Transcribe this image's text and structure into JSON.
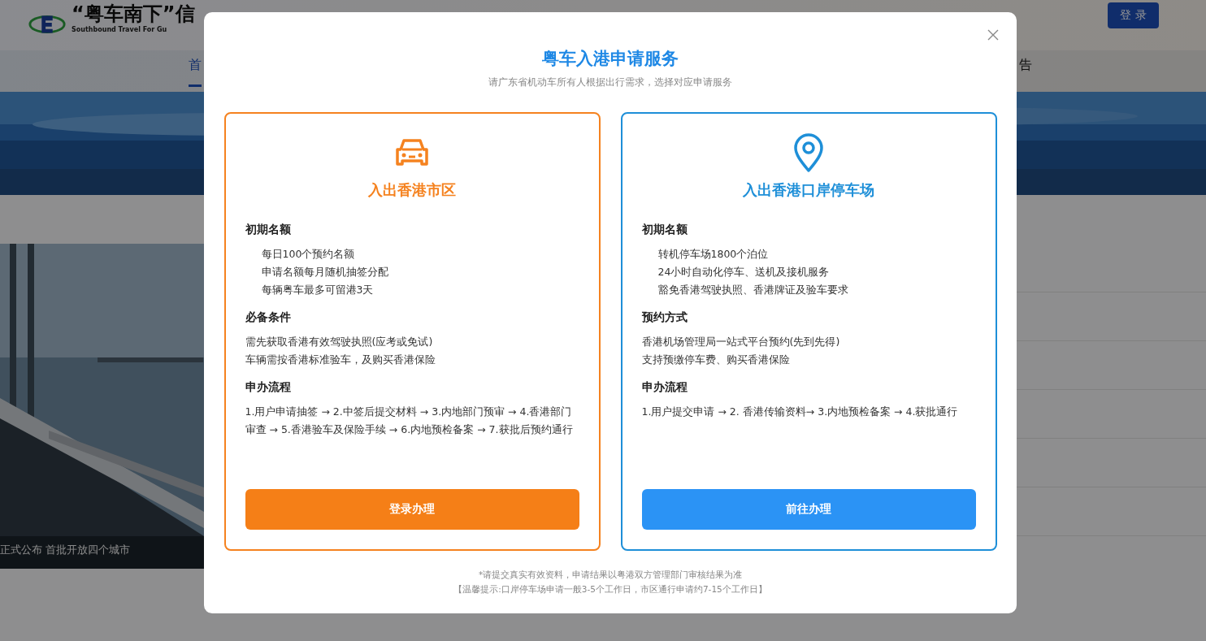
{
  "page": {
    "title": "“粤车南下”信",
    "subtitle": "Southbound Travel For Gu",
    "login_button": "登 录",
    "nav": [
      {
        "label": "首",
        "selected": true
      },
      {
        "label": "告",
        "selected": false
      }
    ],
    "news_caption": "正式公布 首批开放四个城市"
  },
  "modal": {
    "title": "粤车入港申请服务",
    "subtitle": "请广东省机动车所有人根据出行需求，选择对应申请服务",
    "cards": [
      {
        "kind": "car",
        "color": "#f5821f",
        "title": "入出香港市区",
        "sections": [
          {
            "heading": "初期名额",
            "kind": "list",
            "items": [
              "每日100个预约名额",
              "申请名额每月随机抽签分配",
              "每辆粤车最多可留港3天"
            ]
          },
          {
            "heading": "必备条件",
            "kind": "text",
            "items": [
              "需先获取香港有效驾驶执照(应考或免试)",
              "车辆需按香港标准验车，及购买香港保险"
            ]
          },
          {
            "heading": "申办流程",
            "kind": "text",
            "items": [
              "1.用户申请抽签 → 2.中签后提交材料 → 3.内地部门预审 → 4.香港部门审查 → 5.香港验车及保险手续 → 6.内地预检备案 → 7.获批后预约通行"
            ]
          }
        ],
        "button": "登录办理"
      },
      {
        "kind": "pin",
        "color": "#1e8fd8",
        "title": "入出香港口岸停车场",
        "sections": [
          {
            "heading": "初期名额",
            "kind": "list",
            "items": [
              "转机停车场1800个泊位",
              "24小时自动化停车、送机及接机服务",
              "豁免香港驾驶执照、香港牌证及验车要求"
            ]
          },
          {
            "heading": "预约方式",
            "kind": "text",
            "items": [
              "香港机场管理局一站式平台预约(先到先得)",
              "支持预缴停车费、购买香港保险"
            ]
          },
          {
            "heading": "申办流程",
            "kind": "text",
            "items": [
              "1.用户提交申请 → 2. 香港传输资料→ 3.内地预检备案 → 4.获批通行"
            ]
          }
        ],
        "button": "前往办理"
      }
    ],
    "notes": [
      "*请提交真实有效资料，申请结果以粤港双方管理部门审核结果为准",
      "【温馨提示:口岸停车场申请一般3-5个工作日，市区通行申请约7-15个工作日】"
    ]
  }
}
